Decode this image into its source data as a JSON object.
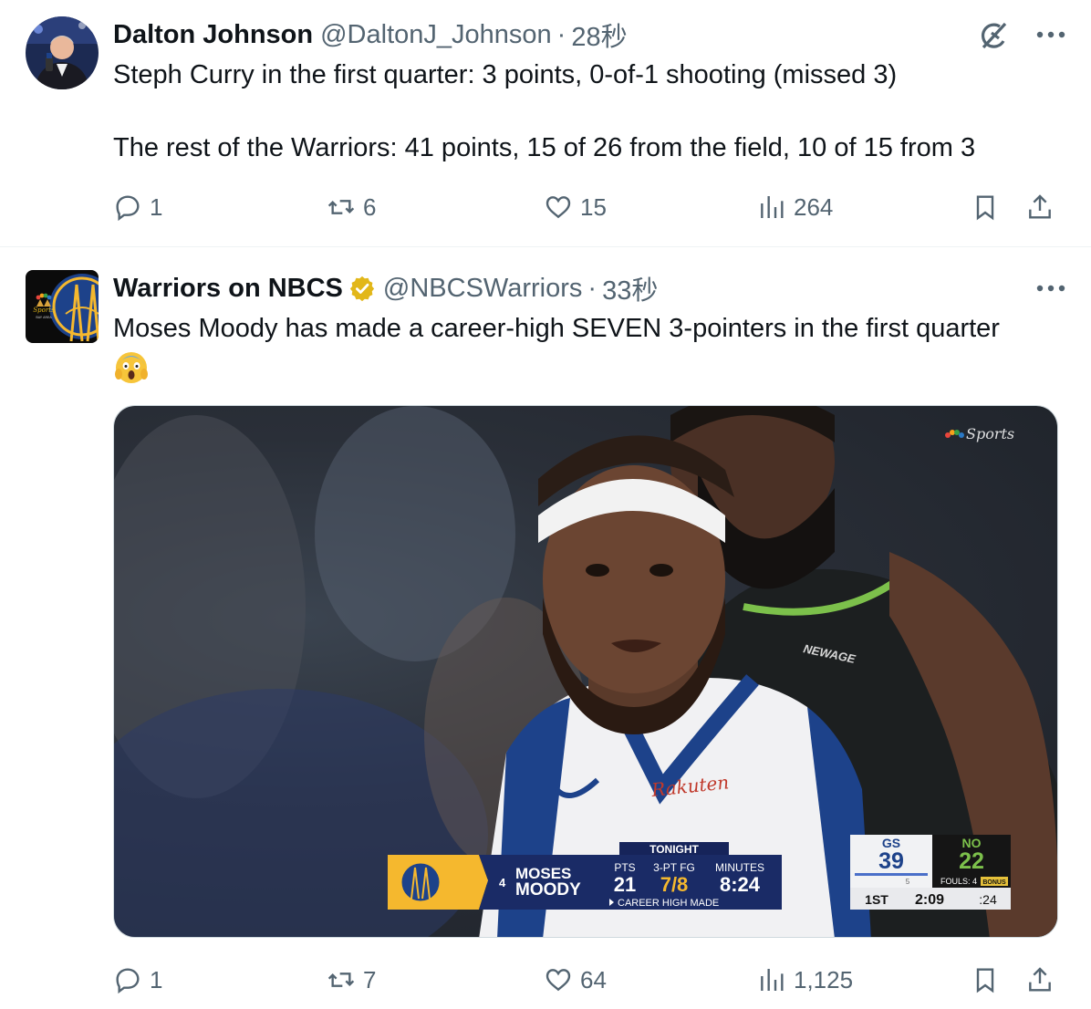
{
  "tweets": [
    {
      "display_name": "Dalton Johnson",
      "handle": "@DaltonJ_Johnson",
      "separator": "·",
      "time": "28秒",
      "text_line1": "Steph Curry in the first quarter: 3 points, 0-of-1 shooting (missed 3)",
      "text_line2": "The rest of the Warriors: 41 points, 15 of 26 from the field, 10 of 15 from 3",
      "replies": "1",
      "reposts": "6",
      "likes": "15",
      "views": "264"
    },
    {
      "display_name": "Warriors on NBCS",
      "handle": "@NBCSWarriors",
      "separator": "·",
      "time": "33秒",
      "text_line1": "Moses Moody has made a career-high SEVEN 3-pointers in the first quarter",
      "emoji": "😱",
      "replies": "1",
      "reposts": "7",
      "likes": "64",
      "views": "1,125",
      "media": {
        "watermark": "Sports",
        "jersey_sponsor": "Rakuten",
        "shirt_text": "NEWAGE",
        "overlay": {
          "tag": "TONIGHT",
          "number": "4",
          "first_name": "MOSES",
          "last_name": "MOODY",
          "col1_label": "PTS",
          "col1_value": "21",
          "col2_label": "3-PT FG",
          "col2_value": "7/8",
          "col3_label": "MINUTES",
          "col3_value": "8:24",
          "footnote": "CAREER HIGH MADE"
        },
        "score": {
          "home_abbr": "GS",
          "home_score": "39",
          "away_abbr": "NO",
          "away_score": "22",
          "fouls": "FOULS: 4",
          "bonus": "BONUS",
          "home_timeouts": "5",
          "period": "1ST",
          "clock": "2:09",
          "shot_clock": ":24"
        }
      }
    }
  ],
  "colors": {
    "text_primary": "#0f1419",
    "text_secondary": "#536471",
    "border": "#cfd9de",
    "verified_gold": "#e2b719",
    "warriors_gold": "#f5b82e",
    "warriors_blue": "#1d428a"
  },
  "icons": [
    "reply-icon",
    "repost-icon",
    "like-icon",
    "views-icon",
    "bookmark-icon",
    "share-icon",
    "more-icon",
    "grok-icon",
    "verified-badge-icon"
  ]
}
